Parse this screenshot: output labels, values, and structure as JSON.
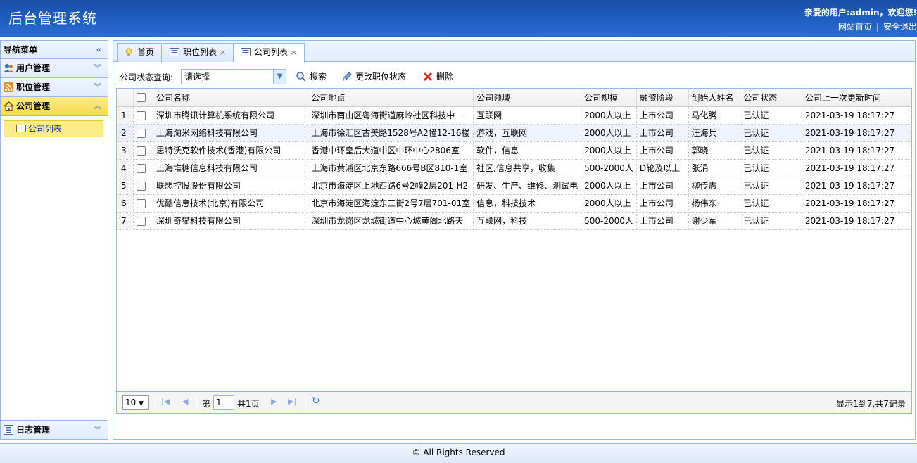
{
  "header": {
    "title": "后台管理系统",
    "user_greeting": "亲爱的用户:admin，欢迎您!",
    "site_home": "网站首页",
    "separator": "|",
    "logout": "安全退出"
  },
  "sidebar": {
    "title": "导航菜单",
    "collapse_icon": "double-chevron-left",
    "groups": [
      {
        "label": "用户管理",
        "icon": "users-icon",
        "expanded": false
      },
      {
        "label": "职位管理",
        "icon": "rss-icon",
        "expanded": false
      },
      {
        "label": "公司管理",
        "icon": "home-icon",
        "expanded": true
      },
      {
        "label": "日志管理",
        "icon": "list-icon",
        "expanded": false
      }
    ],
    "active_item": "公司列表"
  },
  "tabs": [
    {
      "label": "首页",
      "icon": "lightbulb-icon",
      "closable": false
    },
    {
      "label": "职位列表",
      "icon": "table-icon",
      "closable": true
    },
    {
      "label": "公司列表",
      "icon": "table-icon",
      "closable": true,
      "active": true
    }
  ],
  "toolbar": {
    "filter_label": "公司状态查询:",
    "status_select": "请选择",
    "search": "搜索",
    "update_status": "更改职位状态",
    "delete": "删除"
  },
  "grid": {
    "columns": [
      "公司名称",
      "公司地点",
      "公司领域",
      "公司规模",
      "融资阶段",
      "创始人姓名",
      "公司状态",
      "公司上一次更新时间"
    ],
    "rows": [
      {
        "n": "1",
        "name": "深圳市腾讯计算机系统有限公司",
        "location": "深圳市南山区粤海街道麻岭社区科技中一",
        "field": "互联网",
        "size": "2000人以上",
        "stage": "上市公司",
        "founder": "马化腾",
        "status": "已认证",
        "updated": "2021-03-19 18:17:27"
      },
      {
        "n": "2",
        "name": "上海淘米网络科技有限公司",
        "location": "上海市徐汇区古美路1528号A2幢12-16楼",
        "field": "游戏，互联网",
        "size": "2000人以上",
        "stage": "上市公司",
        "founder": "汪海兵",
        "status": "已认证",
        "updated": "2021-03-19 18:17:27"
      },
      {
        "n": "3",
        "name": "思特沃克软件技术(香港)有限公司",
        "location": "香港中环皇后大道中区中环中心2806室",
        "field": "软件，信息",
        "size": "2000人以上",
        "stage": "上市公司",
        "founder": "郭晓",
        "status": "已认证",
        "updated": "2021-03-19 18:17:27"
      },
      {
        "n": "4",
        "name": "上海堆糖信息科技有限公司",
        "location": "上海市黄浦区北京东路666号B区810-1室",
        "field": "社区,信息共享，收集",
        "size": "500-2000人",
        "stage": "D轮及以上",
        "founder": "张涓",
        "status": "已认证",
        "updated": "2021-03-19 18:17:27"
      },
      {
        "n": "5",
        "name": "联想控股股份有限公司",
        "location": "北京市海淀区上地西路6号2幢2层201-H2",
        "field": "研发、生产、维修、测试电",
        "size": "2000人以上",
        "stage": "上市公司",
        "founder": "柳传志",
        "status": "已认证",
        "updated": "2021-03-19 18:17:27"
      },
      {
        "n": "6",
        "name": "优酷信息技术(北京)有限公司",
        "location": "北京市海淀区海淀东三街2号7层701-01室",
        "field": "信息，科技技术",
        "size": "2000人以上",
        "stage": "上市公司",
        "founder": "杨伟东",
        "status": "已认证",
        "updated": "2021-03-19 18:17:27"
      },
      {
        "n": "7",
        "name": "深圳奇猫科技有限公司",
        "location": "深圳市龙岗区龙城街道中心城黄阁北路天",
        "field": "互联网，科技",
        "size": "500-2000人",
        "stage": "上市公司",
        "founder": "谢少军",
        "status": "已认证",
        "updated": "2021-03-19 18:17:27"
      }
    ]
  },
  "pager": {
    "page_size": "10",
    "page_prefix": "第",
    "page_value": "1",
    "page_suffix": "共1页",
    "info": "显示1到7,共7记录"
  },
  "footer": {
    "text": "© All Rights Reserved"
  },
  "colors": {
    "header_blue": "#1f5fc2",
    "border_blue": "#95b8e7",
    "active_yellow": "#fbec88"
  }
}
